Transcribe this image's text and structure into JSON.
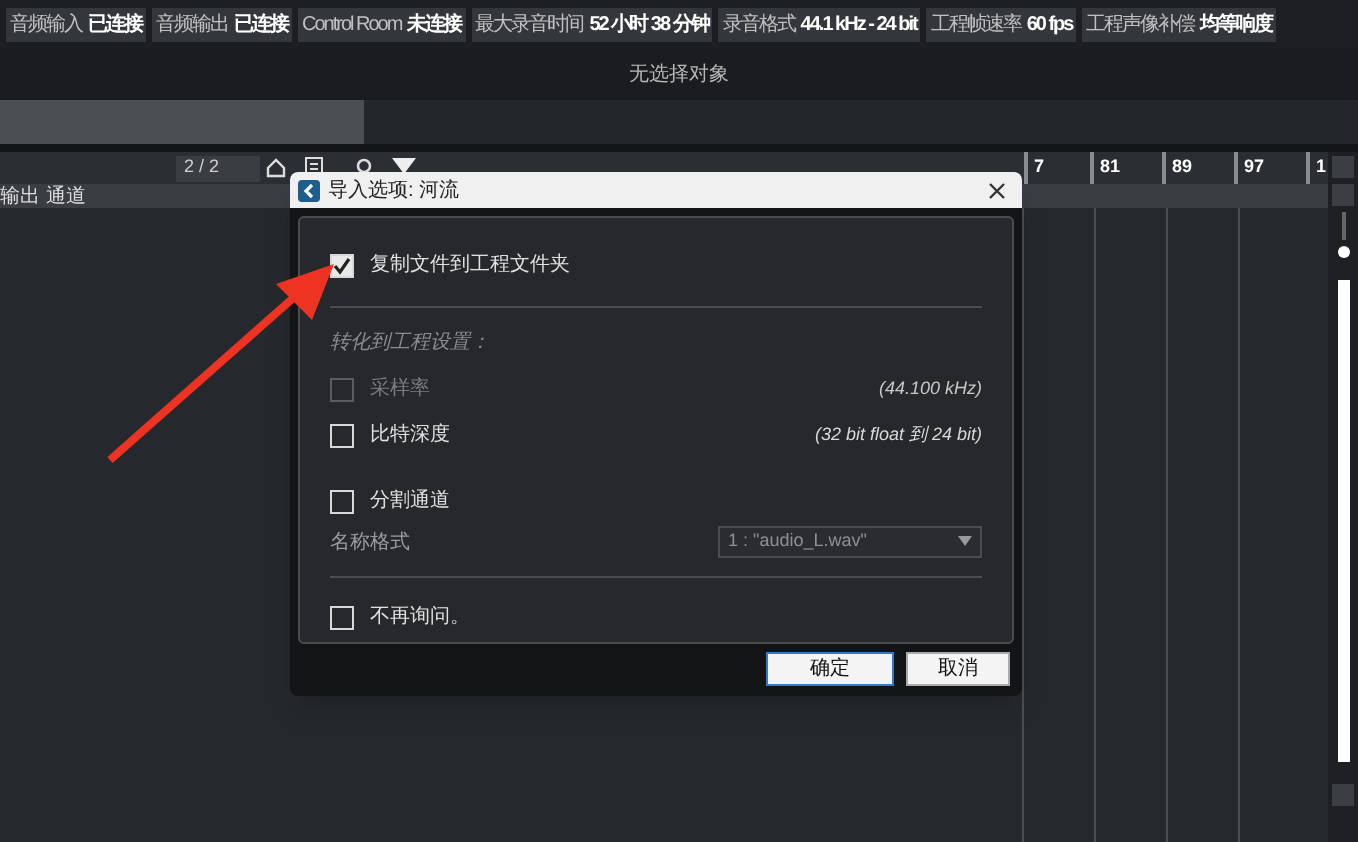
{
  "status_bar": [
    {
      "label": "音频输入",
      "value": "已连接"
    },
    {
      "label": "音频输出",
      "value": "已连接"
    },
    {
      "label": "Control Room",
      "value": "未连接"
    },
    {
      "label": "最大录音时间",
      "value": "52 小时 38 分钟"
    },
    {
      "label": "录音格式",
      "value": "44.1 kHz - 24 bit"
    },
    {
      "label": "工程帧速率",
      "value": "60 fps"
    },
    {
      "label": "工程声像补偿",
      "value": "均等响度"
    }
  ],
  "info_line": "无选择对象",
  "track_toolbar": {
    "counter": "2 / 2"
  },
  "track_header": "输出 通道",
  "ruler": [
    "7",
    "81",
    "89",
    "97",
    "1"
  ],
  "dialog": {
    "title": "导入选项: 河流",
    "copy_option": {
      "label": "复制文件到工程文件夹",
      "checked": true
    },
    "section_title": "转化到工程设置：",
    "convert_options": [
      {
        "label": "采样率",
        "detail": "(44.100 kHz)",
        "checked": false,
        "disabled": true
      },
      {
        "label": "比特深度",
        "detail": "(32 bit float 到 24 bit)",
        "checked": false,
        "disabled": false
      }
    ],
    "split_option": {
      "label": "分割通道",
      "checked": false
    },
    "name_format": {
      "label": "名称格式",
      "value": "1 : \"audio_L.wav\""
    },
    "dont_ask": {
      "label": "不再询问。",
      "checked": false
    },
    "buttons": [
      {
        "label": "确定",
        "default": true
      },
      {
        "label": "取消",
        "default": false
      }
    ]
  }
}
